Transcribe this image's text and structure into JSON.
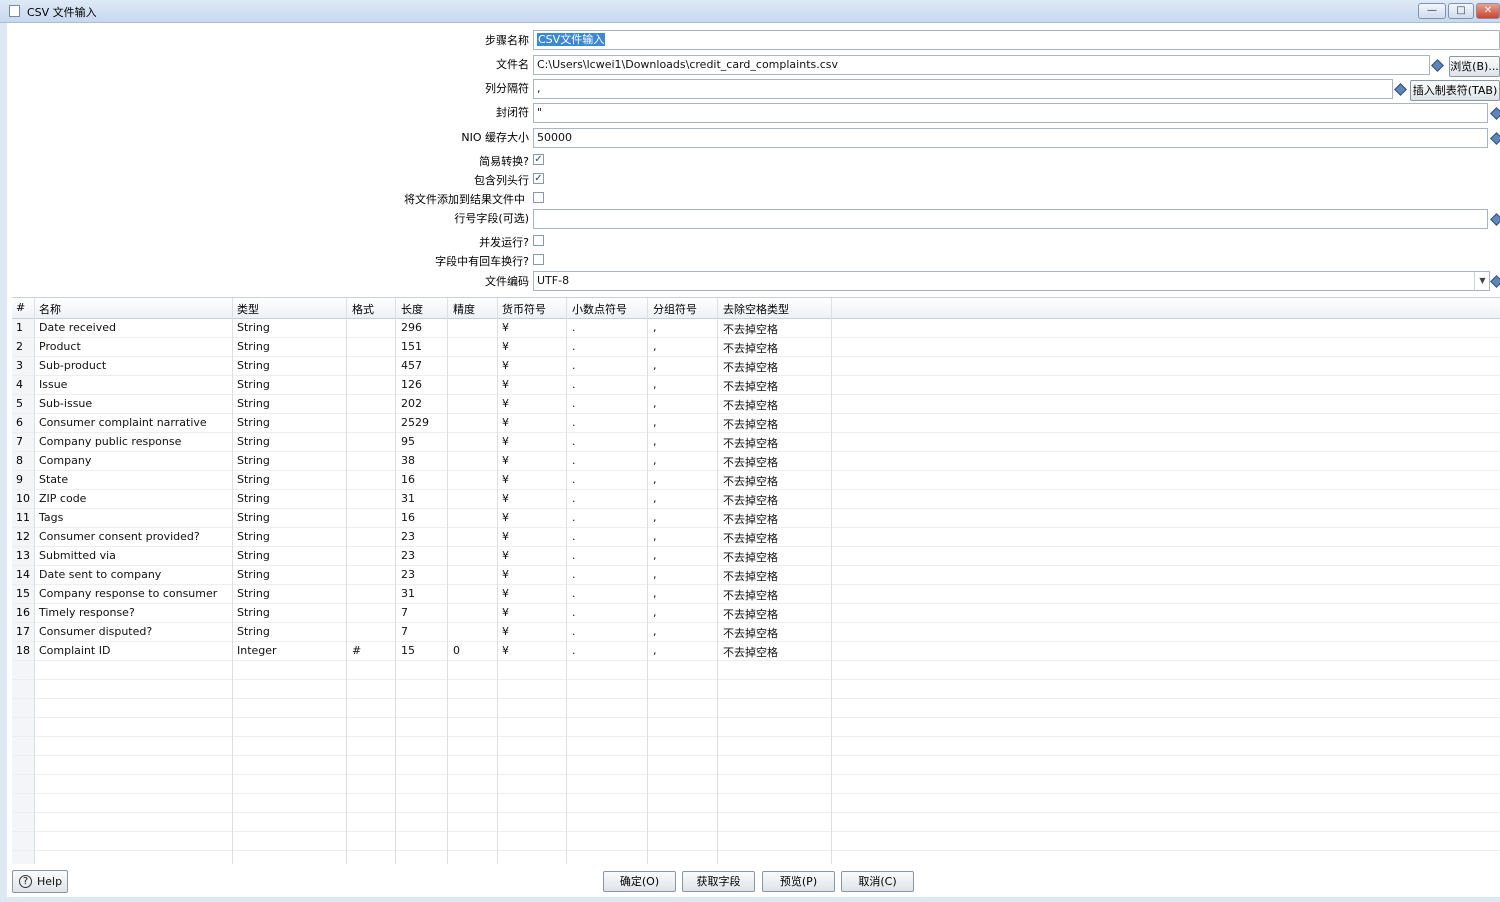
{
  "window": {
    "title": "CSV 文件输入",
    "minimize": "—",
    "maximize": "□",
    "close": "✕"
  },
  "form": {
    "step_name": {
      "label": "步骤名称",
      "value": "CSV文件输入"
    },
    "filename": {
      "label": "文件名",
      "value": "C:\\Users\\lcwei1\\Downloads\\credit_card_complaints.csv",
      "browse": "浏览(B)..."
    },
    "delimiter": {
      "label": "列分隔符",
      "value": ",",
      "insert_tab": "插入制表符(TAB)"
    },
    "enclosure": {
      "label": "封闭符",
      "value": "\""
    },
    "nio_buffer": {
      "label": "NIO 缓存大小",
      "value": "50000"
    },
    "lazy_conversion": {
      "label": "简易转换?",
      "checked": "✓"
    },
    "header_row": {
      "label": "包含列头行",
      "checked": "✓"
    },
    "add_to_result": {
      "label": "将文件添加到结果文件中",
      "checked": ""
    },
    "row_number_field": {
      "label": "行号字段(可选)",
      "value": ""
    },
    "parallel": {
      "label": "并发运行?",
      "checked": ""
    },
    "newline_in_field": {
      "label": "字段中有回车换行?",
      "checked": ""
    },
    "encoding": {
      "label": "文件编码",
      "value": "UTF-8"
    }
  },
  "table": {
    "headers": [
      "#",
      "名称",
      "类型",
      "格式",
      "长度",
      "精度",
      "货币符号",
      "小数点符号",
      "分组符号",
      "去除空格类型"
    ],
    "rows": [
      [
        "1",
        "Date received",
        "String",
        "",
        "296",
        "",
        "¥",
        ".",
        ",",
        "不去掉空格"
      ],
      [
        "2",
        "Product",
        "String",
        "",
        "151",
        "",
        "¥",
        ".",
        ",",
        "不去掉空格"
      ],
      [
        "3",
        "Sub-product",
        "String",
        "",
        "457",
        "",
        "¥",
        ".",
        ",",
        "不去掉空格"
      ],
      [
        "4",
        "Issue",
        "String",
        "",
        "126",
        "",
        "¥",
        ".",
        ",",
        "不去掉空格"
      ],
      [
        "5",
        "Sub-issue",
        "String",
        "",
        "202",
        "",
        "¥",
        ".",
        ",",
        "不去掉空格"
      ],
      [
        "6",
        "Consumer complaint narrative",
        "String",
        "",
        "2529",
        "",
        "¥",
        ".",
        ",",
        "不去掉空格"
      ],
      [
        "7",
        "Company public response",
        "String",
        "",
        "95",
        "",
        "¥",
        ".",
        ",",
        "不去掉空格"
      ],
      [
        "8",
        "Company",
        "String",
        "",
        "38",
        "",
        "¥",
        ".",
        ",",
        "不去掉空格"
      ],
      [
        "9",
        "State",
        "String",
        "",
        "16",
        "",
        "¥",
        ".",
        ",",
        "不去掉空格"
      ],
      [
        "10",
        "ZIP code",
        "String",
        "",
        "31",
        "",
        "¥",
        ".",
        ",",
        "不去掉空格"
      ],
      [
        "11",
        "Tags",
        "String",
        "",
        "16",
        "",
        "¥",
        ".",
        ",",
        "不去掉空格"
      ],
      [
        "12",
        "Consumer consent provided?",
        "String",
        "",
        "23",
        "",
        "¥",
        ".",
        ",",
        "不去掉空格"
      ],
      [
        "13",
        "Submitted via",
        "String",
        "",
        "23",
        "",
        "¥",
        ".",
        ",",
        "不去掉空格"
      ],
      [
        "14",
        "Date sent to company",
        "String",
        "",
        "23",
        "",
        "¥",
        ".",
        ",",
        "不去掉空格"
      ],
      [
        "15",
        "Company response to consumer",
        "String",
        "",
        "31",
        "",
        "¥",
        ".",
        ",",
        "不去掉空格"
      ],
      [
        "16",
        "Timely response?",
        "String",
        "",
        "7",
        "",
        "¥",
        ".",
        ",",
        "不去掉空格"
      ],
      [
        "17",
        "Consumer disputed?",
        "String",
        "",
        "7",
        "",
        "¥",
        ".",
        ",",
        "不去掉空格"
      ],
      [
        "18",
        "Complaint ID",
        "Integer",
        "#",
        "15",
        "0",
        "¥",
        ".",
        ",",
        "不去掉空格"
      ]
    ]
  },
  "buttons": {
    "help": "Help",
    "ok": "确定(O)",
    "get_fields": "获取字段",
    "preview": "预览(P)",
    "cancel": "取消(C)"
  }
}
